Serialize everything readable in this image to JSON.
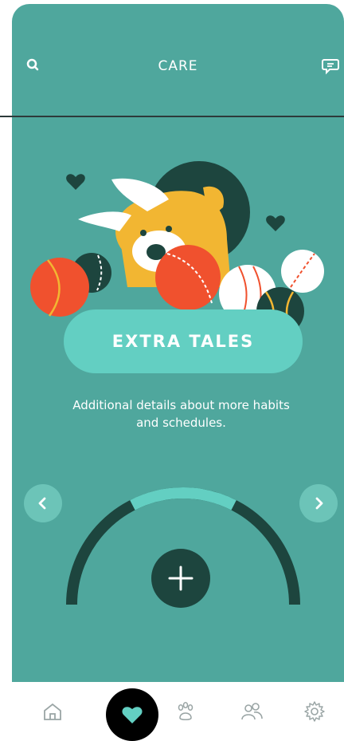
{
  "header": {
    "title": "CARE",
    "search_icon": "search-icon",
    "chat_icon": "chat-icon"
  },
  "card": {
    "title": "EXTRA TALES",
    "description": "Additional details about more habits and schedules."
  },
  "carousel": {
    "prev_icon": "chevron-left-icon",
    "next_icon": "chevron-right-icon"
  },
  "progress": {
    "active_segment_fraction": 0.3
  },
  "tabbar": {
    "items": [
      {
        "icon": "home-icon",
        "active": false
      },
      {
        "icon": "heart-icon",
        "active": true
      },
      {
        "icon": "paw-icon",
        "active": false
      },
      {
        "icon": "people-icon",
        "active": false
      },
      {
        "icon": "gear-icon",
        "active": false
      }
    ]
  },
  "colors": {
    "background": "#4fa79d",
    "accent": "#63cfc2",
    "dark": "#1d453e",
    "ball_red": "#f0512e",
    "dog_yellow": "#f2b632"
  }
}
